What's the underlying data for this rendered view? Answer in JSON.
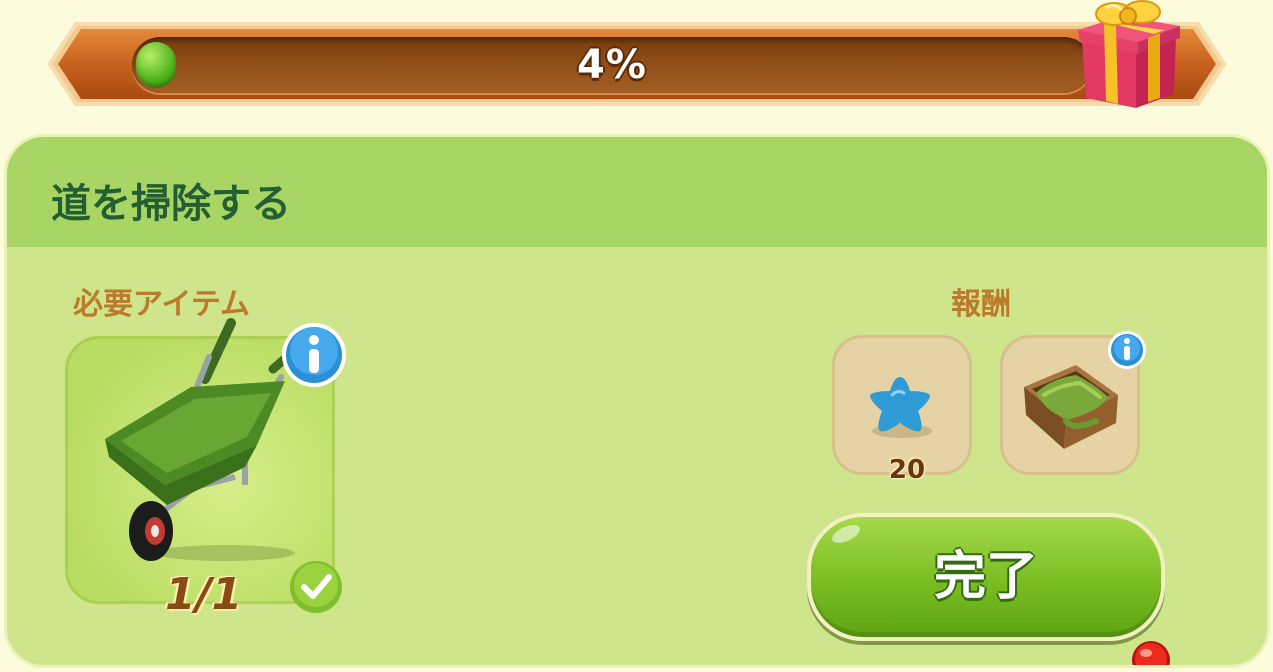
{
  "progress": {
    "value_percent": 4,
    "label": "4%",
    "fill_color": "#4fb21a"
  },
  "task": {
    "title": "道を掃除する"
  },
  "required": {
    "label": "必要アイテム",
    "item_icon": "wheelbarrow-icon",
    "count": "1/1",
    "status_icon": "check-icon"
  },
  "rewards": {
    "label": "報酬",
    "items": [
      {
        "icon": "blue-star-icon",
        "amount": "20"
      },
      {
        "icon": "grass-crate-icon"
      }
    ]
  },
  "complete_button": {
    "label": "完了",
    "color": "#79bd23"
  },
  "colors": {
    "banner": "#c8611e",
    "panel": "#cfe58b",
    "panel_header": "#a8d564",
    "title_text": "#245e33",
    "section_text": "#bb7a2c",
    "reward_card": "#e5d3a6"
  }
}
